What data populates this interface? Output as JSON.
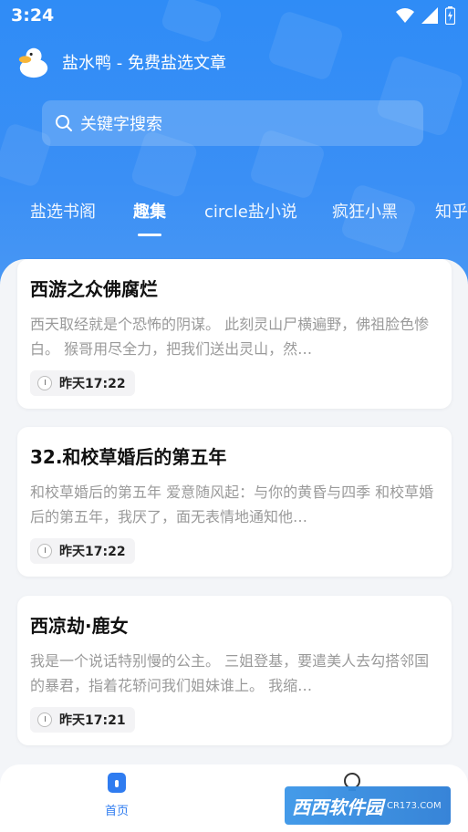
{
  "status_bar": {
    "time": "3:24"
  },
  "app_bar": {
    "title": "盐水鸭 - 免费盐选文章"
  },
  "search": {
    "placeholder": "关键字搜索"
  },
  "tabs": [
    {
      "label": "盐选书阁",
      "active": false
    },
    {
      "label": "趣集",
      "active": true
    },
    {
      "label": "circle盐小说",
      "active": false
    },
    {
      "label": "疯狂小黑",
      "active": false
    },
    {
      "label": "知乎",
      "active": false
    }
  ],
  "articles": [
    {
      "title": "西游之众佛腐烂",
      "description": "西天取经就是个恐怖的阴谋。 此刻灵山尸横遍野，佛祖脸色惨白。 猴哥用尽全力，把我们送出灵山，然…",
      "time": "昨天17:22"
    },
    {
      "title": "32.和校草婚后的第五年",
      "description": "和校草婚后的第五年 爱意随风起：与你的黄昏与四季 和校草婚后的第五年，我厌了，面无表情地通知他…",
      "time": "昨天17:22"
    },
    {
      "title": "西凉劫·鹿女",
      "description": "我是一个说话特别慢的公主。 三姐登基，要遣美人去勾搭邻国的暴君，指着花轿问我们姐妹谁上。 我缩…",
      "time": "昨天17:21"
    }
  ],
  "bottom_nav": {
    "home_label": "首页"
  },
  "watermark": {
    "main": "西西软件园",
    "sub": "CR173.COM"
  },
  "colors": {
    "brand_blue": "#2f8cf6",
    "nav_active": "#2f7cf0"
  }
}
